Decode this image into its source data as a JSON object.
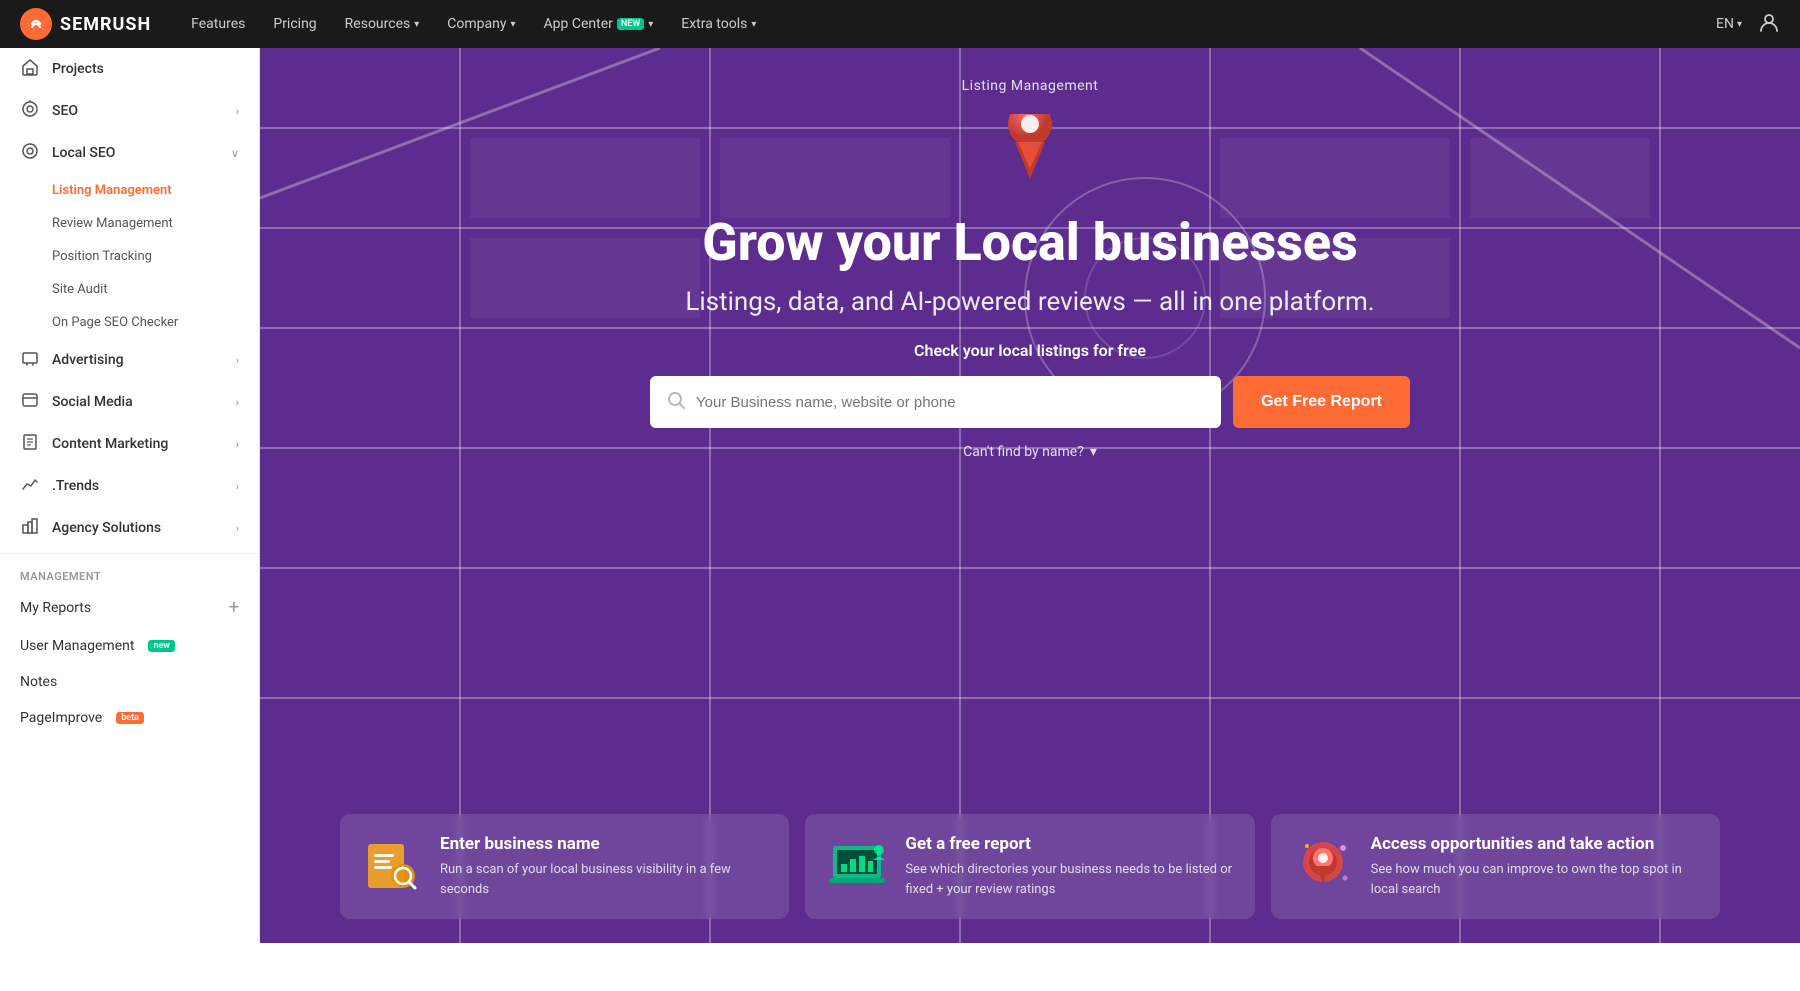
{
  "topnav": {
    "logo_text": "SEMRUSH",
    "items": [
      {
        "label": "Features",
        "has_dropdown": false
      },
      {
        "label": "Pricing",
        "has_dropdown": false
      },
      {
        "label": "Resources",
        "has_dropdown": true
      },
      {
        "label": "Company",
        "has_dropdown": true
      },
      {
        "label": "App Center",
        "has_dropdown": true,
        "badge": "NEW"
      },
      {
        "label": "Extra tools",
        "has_dropdown": true
      }
    ],
    "lang": "EN",
    "user_icon": "👤"
  },
  "sidebar": {
    "main_items": [
      {
        "id": "projects",
        "label": "Projects",
        "icon": "⌂",
        "has_arrow": false
      },
      {
        "id": "seo",
        "label": "SEO",
        "icon": "⚙",
        "has_arrow": true
      },
      {
        "id": "local-seo",
        "label": "Local SEO",
        "icon": "◎",
        "has_arrow": true,
        "expanded": true
      }
    ],
    "local_seo_sub": [
      {
        "id": "listing-management",
        "label": "Listing Management",
        "active": true
      },
      {
        "id": "review-management",
        "label": "Review Management"
      },
      {
        "id": "position-tracking",
        "label": "Position Tracking"
      },
      {
        "id": "site-audit",
        "label": "Site Audit"
      },
      {
        "id": "on-page-seo",
        "label": "On Page SEO Checker"
      }
    ],
    "other_items": [
      {
        "id": "advertising",
        "label": "Advertising",
        "icon": "◻",
        "has_arrow": true
      },
      {
        "id": "social-media",
        "label": "Social Media",
        "icon": "◻",
        "has_arrow": true
      },
      {
        "id": "content-marketing",
        "label": "Content Marketing",
        "icon": "◻",
        "has_arrow": true
      },
      {
        "id": "trends",
        "label": ".Trends",
        "icon": "◻",
        "has_arrow": true
      },
      {
        "id": "agency-solutions",
        "label": "Agency Solutions",
        "icon": "◻",
        "has_arrow": true
      }
    ],
    "management_label": "MANAGEMENT",
    "management_items": [
      {
        "id": "my-reports",
        "label": "My Reports",
        "has_plus": true
      },
      {
        "id": "user-management",
        "label": "User Management",
        "badge": "new"
      },
      {
        "id": "notes",
        "label": "Notes"
      },
      {
        "id": "pageimprove",
        "label": "PageImprove",
        "badge": "beta"
      }
    ]
  },
  "hero": {
    "label": "Listing Management",
    "title": "Grow your Local businesses",
    "subtitle": "Listings, data, and AI-powered reviews — all in one platform.",
    "cta_label": "Check your local listings for free",
    "search_placeholder": "Your Business name, website or phone",
    "get_report_btn": "Get Free Report",
    "cant_find": "Can't find by name?"
  },
  "features": [
    {
      "id": "enter-business",
      "title": "Enter business name",
      "desc": "Run a scan of your local business visibility in a few seconds",
      "icon_color": "#f5a623"
    },
    {
      "id": "get-report",
      "title": "Get a free report",
      "desc": "See which directories your business needs to be listed or fixed + your review ratings",
      "icon_color": "#00c58e"
    },
    {
      "id": "access-opportunities",
      "title": "Access opportunities and take action",
      "desc": "See how much you can improve to own the top spot in local search",
      "icon_color": "#e8453c"
    }
  ],
  "colors": {
    "accent_orange": "#ff6b35",
    "sidebar_active_bg": "#fff0eb",
    "hero_bg": "#5c2d8e",
    "badge_green": "#00c58e"
  }
}
